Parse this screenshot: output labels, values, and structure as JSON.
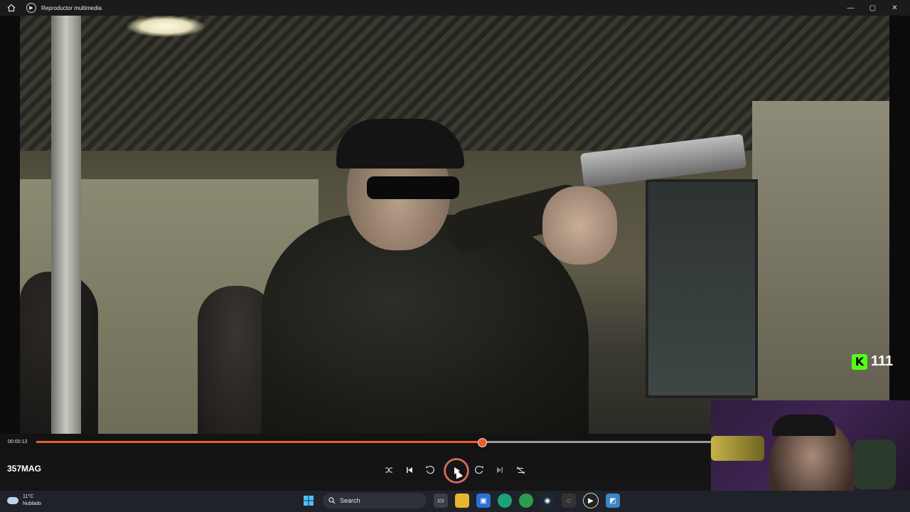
{
  "window": {
    "title": "Reproductor multimedia",
    "minimize": "—",
    "maximize": "▢",
    "close": "✕"
  },
  "overlay": {
    "kick_count": "111"
  },
  "player": {
    "elapsed": "00:00:13",
    "progress": 0.66,
    "media_title": "357MAG"
  },
  "taskbar": {
    "temp": "11°C",
    "condition": "Nublado",
    "search_placeholder": "Search"
  },
  "colors": {
    "accent": "#e85f2a",
    "kick": "#53fc18"
  }
}
